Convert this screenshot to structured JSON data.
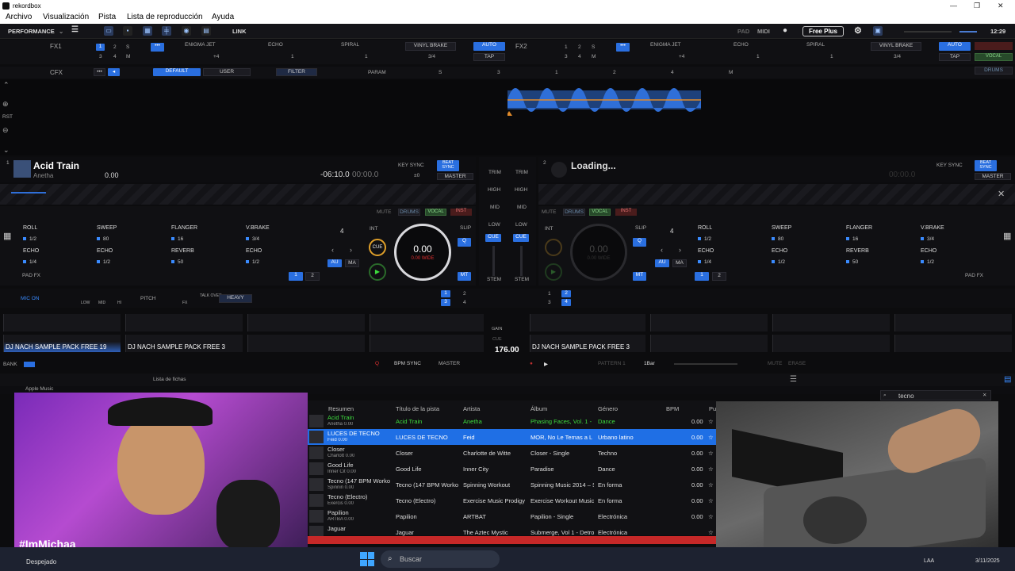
{
  "window": {
    "title": "rekordbox",
    "minimize": "—",
    "maximize": "❐",
    "close": "✕"
  },
  "menu": [
    "Archivo",
    "Visualización",
    "Pista",
    "Lista de reproducción",
    "Ayuda"
  ],
  "toolbar": {
    "mode": "PERFORMANCE",
    "link": "LINK",
    "pad": "PAD",
    "midi": "MIDI",
    "plan": "Free Plus",
    "clock": "12:29"
  },
  "fx1": {
    "label": "FX1",
    "beat_buttons": [
      "1",
      "2",
      "S",
      "3",
      "4",
      "M"
    ],
    "effects": [
      "ENIGMA JET",
      "ECHO",
      "SPIRAL"
    ],
    "vinyl_brake": "VINYL BRAKE",
    "auto": "AUTO",
    "tap": "TAP",
    "vals": [
      "+4",
      "1",
      "1",
      "3/4"
    ]
  },
  "fx2": {
    "label": "FX2",
    "beat_buttons": [
      "1",
      "2",
      "S",
      "3",
      "4",
      "M"
    ],
    "effects": [
      "ENIGMA JET",
      "ECHO",
      "SPIRAL"
    ],
    "vinyl_brake": "VINYL BRAKE",
    "auto": "AUTO",
    "tap": "TAP",
    "vocal": "VOCAL",
    "drums": "DRUMS",
    "vals": [
      "+4",
      "1",
      "1",
      "3/4"
    ]
  },
  "cfx": {
    "label": "CFX",
    "default": "DEFAULT",
    "user": "USER",
    "filter": "FILTER",
    "param": "PARAM",
    "s": "S",
    "nums": [
      "3",
      "1",
      "2",
      "4"
    ],
    "m": "M"
  },
  "overview": {
    "rst": "RST"
  },
  "deck1": {
    "num": "1",
    "title": "Acid Train",
    "artist": "Anetha",
    "bpm": "0.00",
    "time_remaining": "-06:10.0",
    "time_elapsed": "00:00.0",
    "key_sync": "KEY SYNC",
    "key_val": "±0",
    "beat_sync": "BEAT SYNC",
    "master": "MASTER"
  },
  "deck2": {
    "num": "2",
    "title": "Loading...",
    "key_sync": "KEY SYNC",
    "beat_sync": "BEAT SYNC",
    "master": "MASTER",
    "time_elapsed": "00:00.0"
  },
  "mixer": {
    "trim": "TRIM",
    "high": "HIGH",
    "mid": "MID",
    "low": "LOW",
    "cue": "CUE",
    "stem": "STEM"
  },
  "fx_stems": {
    "mute": "MUTE",
    "drums": "DRUMS",
    "vocal": "VOCAL",
    "inst": "INST"
  },
  "pads_left": [
    {
      "name": "ROLL",
      "val": "1/2"
    },
    {
      "name": "SWEEP",
      "val": "80"
    },
    {
      "name": "FLANGER",
      "val": "16"
    },
    {
      "name": "V.BRAKE",
      "val": "3/4"
    },
    {
      "name": "ECHO",
      "val": "1/4"
    },
    {
      "name": "ECHO",
      "val": "1/2"
    },
    {
      "name": "REVERB",
      "val": "50"
    },
    {
      "name": "ECHO",
      "val": "1/2"
    }
  ],
  "pads_right": [
    {
      "name": "ROLL",
      "val": "1/2"
    },
    {
      "name": "SWEEP",
      "val": "80"
    },
    {
      "name": "FLANGER",
      "val": "16"
    },
    {
      "name": "V.BRAKE",
      "val": "3/4"
    },
    {
      "name": "ECHO",
      "val": "1/4"
    },
    {
      "name": "ECHO",
      "val": "1/2"
    },
    {
      "name": "REVERB",
      "val": "50"
    },
    {
      "name": "ECHO",
      "val": "1/2"
    }
  ],
  "deck1_ctrl": {
    "padfx": "PAD FX",
    "beat": "4",
    "int": "INT",
    "cue": "CUE",
    "slip": "SLIP",
    "q": "Q",
    "au": "AU",
    "ma": "MA",
    "mt": "MT",
    "jog_val": "0.00",
    "jog_sub": "0.00 WIDE",
    "p1": "1",
    "p2": "2"
  },
  "deck2_ctrl": {
    "padfx": "PAD FX",
    "beat": "4",
    "int": "INT",
    "slip": "SLIP",
    "q": "Q",
    "au": "AU",
    "ma": "MA",
    "mt": "MT",
    "jog_val": "0.00",
    "jog_sub": "0.00 WIDE",
    "p1": "1",
    "p2": "2"
  },
  "strip": {
    "mic": "MIC ON",
    "low": "LOW",
    "mid": "MID",
    "hi": "HI",
    "pitch": "PITCH",
    "fx": "FX",
    "talkover": "TALK OVER",
    "heavy": "HEAVY",
    "grid": [
      "1",
      "2",
      "3",
      "4"
    ]
  },
  "sampler": {
    "slots": [
      "DJ NACH SAMPLE PACK FREE 19",
      "DJ NACH SAMPLE PACK FREE 3",
      "",
      "",
      "DJ NACH SAMPLE PACK FREE 3",
      "",
      "",
      ""
    ],
    "gain": "GAIN",
    "cue": "CUE",
    "bpm": "176.00",
    "bpm_sync": "BPM SYNC",
    "master": "MASTER",
    "pattern": "PATTERN 1",
    "bar": "1Bar",
    "mute": "MUTE",
    "erase": "ERASE",
    "bank": "BANK",
    "q": "Q"
  },
  "tree": {
    "apple_music": "Apple Music",
    "fichas": "Lista de fichas"
  },
  "search": {
    "value": "tecno"
  },
  "columns": [
    "Resumen",
    "Título de la pista",
    "Artista",
    "Álbum",
    "Género",
    "BPM",
    "Pu"
  ],
  "tracks": [
    {
      "sum_title": "Acid Train",
      "sum_sub": "Anetha  0.00",
      "title": "Acid Train",
      "artist": "Anetha",
      "album": "Phasing Faces, Vol. 1 -",
      "genre": "Dance",
      "bpm": "0.00",
      "playing": true
    },
    {
      "sum_title": "LUCES DE TECNO",
      "sum_sub": "Feid  0.00",
      "title": "LUCES DE TECNO",
      "artist": "Feid",
      "album": "MOR, No Le Temas a L",
      "genre": "Urbano latino",
      "bpm": "0.00",
      "selected": true
    },
    {
      "sum_title": "Closer",
      "sum_sub": "Charlott  0.00",
      "title": "Closer",
      "artist": "Charlotte de Witte",
      "album": "Closer - Single",
      "genre": "Techno",
      "bpm": "0.00"
    },
    {
      "sum_title": "Good Life",
      "sum_sub": "Inner Cit  0.00",
      "title": "Good Life",
      "artist": "Inner City",
      "album": "Paradise",
      "genre": "Dance",
      "bpm": "0.00"
    },
    {
      "sum_title": "Tecno (147 BPM Worko",
      "sum_sub": "Spinnin  0.00",
      "title": "Tecno (147 BPM Worko",
      "artist": "Spinning Workout",
      "album": "Spinning Music 2014 – S",
      "genre": "En forma",
      "bpm": "0.00"
    },
    {
      "sum_title": "Tecno (Electro)",
      "sum_sub": "Exercis  0.00",
      "title": "Tecno (Electro)",
      "artist": "Exercise Music Prodigy",
      "album": "Exercise Workout Music",
      "genre": "En forma",
      "bpm": "0.00"
    },
    {
      "sum_title": "Papilion",
      "sum_sub": "ARTBA  0.00",
      "title": "Papilion",
      "artist": "ARTBAT",
      "album": "Papilion - Single",
      "genre": "Electrónica",
      "bpm": "0.00"
    },
    {
      "sum_title": "Jaguar",
      "sum_sub": "",
      "title": "Jaguar",
      "artist": "The Aztec Mystic",
      "album": "Submerge, Vol 1 - Detroi",
      "genre": "Electrónica",
      "bpm": ""
    }
  ],
  "overlay": {
    "handle": "#ImMichaa"
  },
  "taskbar": {
    "weather": "Despejado",
    "search": "Buscar",
    "lang": "LAA",
    "date": "3/11/2025"
  },
  "colors": {
    "accent": "#2a6fe0",
    "selected_row": "#1f6fe5",
    "playing_text": "#3ddc3d",
    "wave": "#2f6fd8"
  }
}
